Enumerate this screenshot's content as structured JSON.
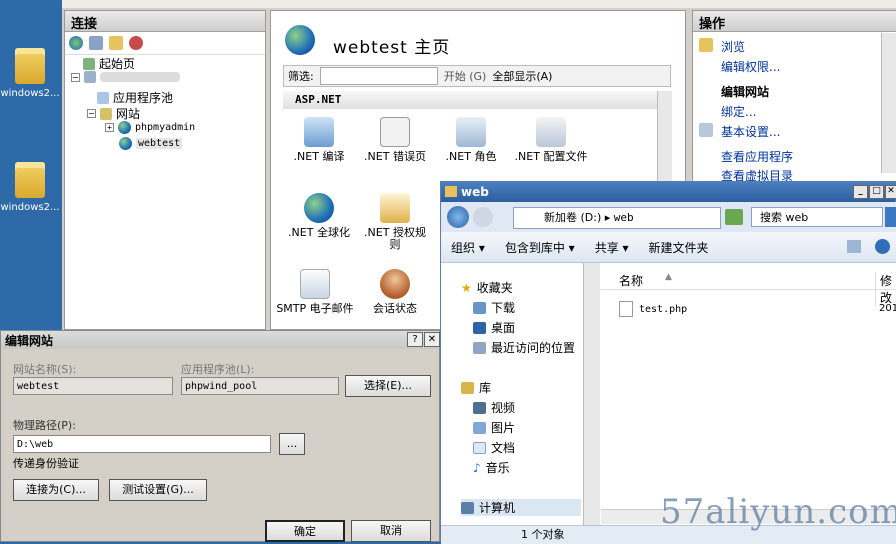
{
  "desktop": {
    "icons": [
      {
        "label": "windows2..."
      },
      {
        "label": "windows2..."
      }
    ]
  },
  "iis": {
    "connections": {
      "title": "连接",
      "tree": {
        "start_page": "起始页",
        "app_pools": "应用程序池",
        "sites": "网站",
        "site1": "phpmyadmin",
        "site2": "webtest"
      }
    },
    "home": {
      "title": "webtest  主页",
      "filter_label": "筛选:",
      "start_btn": "开始 (G)",
      "show_all": "全部显示(A)",
      "section": "ASP.NET",
      "features": [
        {
          "label": ".NET 编译"
        },
        {
          "label": ".NET 错误页"
        },
        {
          "label": ".NET 角色"
        },
        {
          "label": ".NET 配置文件"
        },
        {
          "label": ".NET 全球化"
        },
        {
          "label": ".NET 授权规则"
        },
        {
          "label": "SMTP 电子邮件"
        },
        {
          "label": "会话状态"
        }
      ]
    },
    "actions": {
      "title": "操作",
      "items": [
        "浏览",
        "编辑权限...",
        "编辑网站",
        "绑定...",
        "基本设置...",
        "查看应用程序",
        "查看虚拟目录"
      ]
    }
  },
  "dialog": {
    "title": "编辑网站",
    "help": "?",
    "close": "✕",
    "site_name_label": "网站名称(S):",
    "site_name": "webtest",
    "pool_label": "应用程序池(L):",
    "pool": "phpwind_pool",
    "select_btn": "选择(E)...",
    "path_label": "物理路径(P):",
    "path": "D:\\web",
    "browse_btn": "...",
    "auth_label": "传递身份验证",
    "connect_as": "连接为(C)...",
    "test_settings": "测试设置(G)...",
    "ok": "确定",
    "cancel": "取消"
  },
  "explorer": {
    "title": "web",
    "breadcrumb": [
      "新加卷 (D:)",
      "web"
    ],
    "search_placeholder": "搜索 web",
    "commands": [
      "组织 ▾",
      "包含到库中 ▾",
      "共享 ▾",
      "新建文件夹"
    ],
    "nav": {
      "favorites": "收藏夹",
      "downloads": "下载",
      "desktop": "桌面",
      "recent": "最近访问的位置",
      "libraries": "库",
      "videos": "视频",
      "pictures": "图片",
      "documents": "文档",
      "music": "音乐",
      "computer": "计算机"
    },
    "col_name": "名称",
    "col_modified": "修改",
    "files": [
      {
        "name": "test.php",
        "modified": "201"
      }
    ],
    "status": "1 个对象"
  },
  "watermark": "57aliyun.com",
  "colors": {
    "desktop": "#2f6aa8",
    "titlebar": "#2c5f9e",
    "link": "#003399"
  }
}
